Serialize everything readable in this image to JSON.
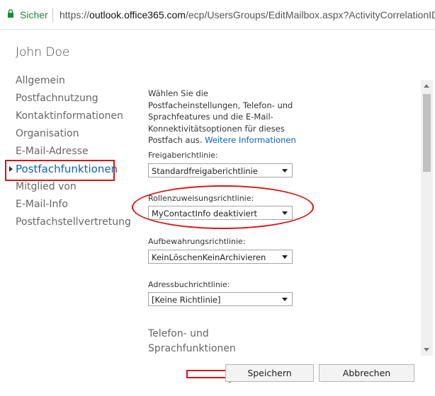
{
  "browser": {
    "secure_label": "Sicher",
    "url_prefix": "https://",
    "url_host": "outlook.office365.com",
    "url_path": "/ecp/UsersGroups/EditMailbox.aspx?ActivityCorrelationID"
  },
  "dialog": {
    "title": "John Doe"
  },
  "nav": {
    "items": [
      {
        "label": "Allgemein"
      },
      {
        "label": "Postfachnutzung"
      },
      {
        "label": "Kontaktinformationen"
      },
      {
        "label": "Organisation"
      },
      {
        "label": "E-Mail-Adresse"
      },
      {
        "label": "Postfachfunktionen",
        "active": true
      },
      {
        "label": "Mitglied von"
      },
      {
        "label": "E-Mail-Info"
      },
      {
        "label": "Postfachstellvertretung"
      }
    ]
  },
  "content": {
    "intro_text": "Wählen Sie die Postfacheinstellungen, Telefon- und Sprachfeatures und die E-Mail-Konnektivitätsoptionen für dieses Postfach aus.",
    "intro_link": "Weitere Informationen",
    "fields": [
      {
        "label": "Freigaberichtlinie:",
        "value": "Standardfreigaberichtlinie"
      },
      {
        "label": "Rollenzuweisungsrichtlinie:",
        "value": "MyContactInfo deaktiviert"
      },
      {
        "label": "Aufbewahrungsrichtlinie:",
        "value": "KeinLöschenKeinArchivieren"
      },
      {
        "label": "Adressbuchrichtlinie:",
        "value": "[Keine Richtlinie]"
      }
    ],
    "section_heading_line1": "Telefon- und",
    "section_heading_line2": "Sprachfunktionen"
  },
  "footer": {
    "save_label": "Speichern",
    "cancel_label": "Abbrechen"
  },
  "annotation_color": "#d11111",
  "accent_color": "#0b63b6"
}
